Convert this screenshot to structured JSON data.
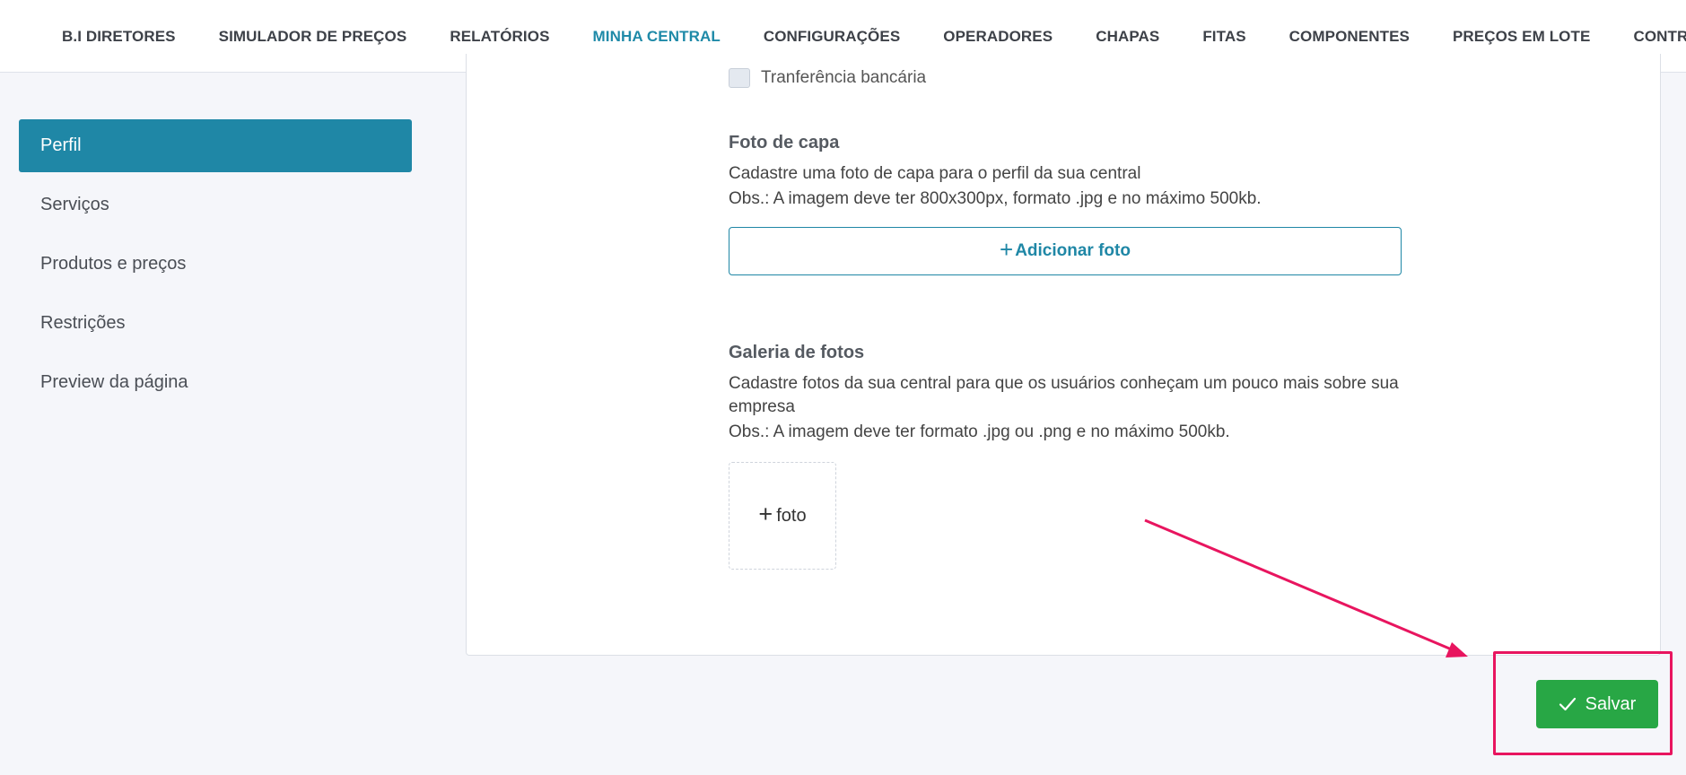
{
  "nav": {
    "items": [
      {
        "label": "B.I DIRETORES",
        "active": false
      },
      {
        "label": "SIMULADOR DE PREÇOS",
        "active": false
      },
      {
        "label": "RELATÓRIOS",
        "active": false
      },
      {
        "label": "MINHA CENTRAL",
        "active": true
      },
      {
        "label": "CONFIGURAÇÕES",
        "active": false
      },
      {
        "label": "OPERADORES",
        "active": false
      },
      {
        "label": "CHAPAS",
        "active": false
      },
      {
        "label": "FITAS",
        "active": false
      },
      {
        "label": "COMPONENTES",
        "active": false
      },
      {
        "label": "PREÇOS EM LOTE",
        "active": false
      },
      {
        "label": "CONTRAT",
        "active": false
      }
    ]
  },
  "sidebar": {
    "items": [
      {
        "label": "Perfil",
        "active": true
      },
      {
        "label": "Serviços",
        "active": false
      },
      {
        "label": "Produtos e preços",
        "active": false
      },
      {
        "label": "Restrições",
        "active": false
      },
      {
        "label": "Preview da página",
        "active": false
      }
    ]
  },
  "payment": {
    "checkbox_label": "Tranferência bancária"
  },
  "cover_photo": {
    "title": "Foto de capa",
    "description": "Cadastre uma foto de capa para o perfil da sua central",
    "note": "Obs.: A imagem deve ter 800x300px, formato .jpg e no máximo 500kb.",
    "button_label": "Adicionar foto"
  },
  "gallery": {
    "title": "Galeria de fotos",
    "description": "Cadastre fotos da sua central para que os usuários conheçam um pouco mais sobre sua empresa",
    "note": "Obs.: A imagem deve ter formato .jpg ou .png e no máximo 500kb.",
    "add_label": "foto"
  },
  "actions": {
    "save_label": "Salvar"
  },
  "colors": {
    "accent": "#1f87a6",
    "save": "#28a745",
    "annotation": "#e8155f"
  },
  "icons": {
    "plus": "plus-icon",
    "check": "check-icon"
  }
}
